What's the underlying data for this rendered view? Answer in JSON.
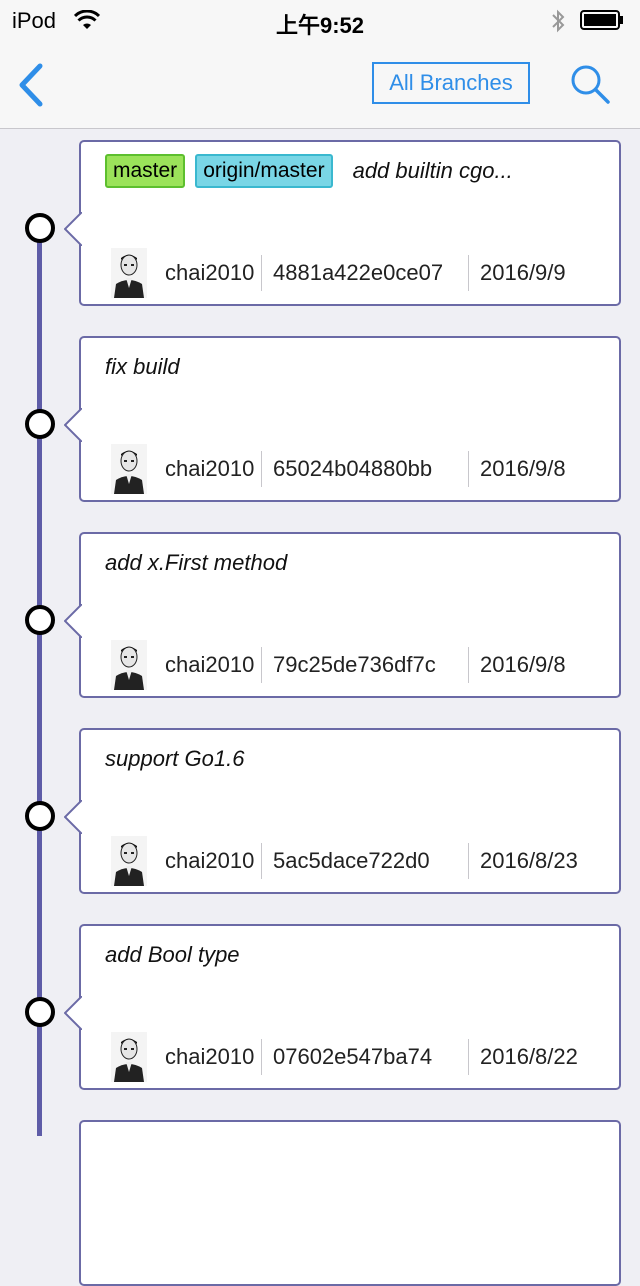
{
  "status_bar": {
    "carrier": "iPod",
    "time": "上午9:52"
  },
  "nav": {
    "branches_label": "All Branches",
    "back_icon": "chevron-left-icon",
    "search_icon": "search-icon"
  },
  "colors": {
    "accent": "#2f8ee8",
    "timeline": "#5e5ca7",
    "tag_local": "#9be35a",
    "tag_remote": "#79d6e6"
  },
  "commits": [
    {
      "tags": [
        "master",
        "origin/master"
      ],
      "message": "add builtin cgo...",
      "author": "chai2010",
      "sha": "4881a422e0ce07",
      "date": "2016/9/9"
    },
    {
      "tags": [],
      "message": "fix build",
      "author": "chai2010",
      "sha": "65024b04880bb",
      "date": "2016/9/8"
    },
    {
      "tags": [],
      "message": "add x.First method",
      "author": "chai2010",
      "sha": "79c25de736df7c",
      "date": "2016/9/8"
    },
    {
      "tags": [],
      "message": "support Go1.6",
      "author": "chai2010",
      "sha": "5ac5dace722d0",
      "date": "2016/8/23"
    },
    {
      "tags": [],
      "message": "add Bool type",
      "author": "chai2010",
      "sha": "07602e547ba74",
      "date": "2016/8/22"
    }
  ]
}
